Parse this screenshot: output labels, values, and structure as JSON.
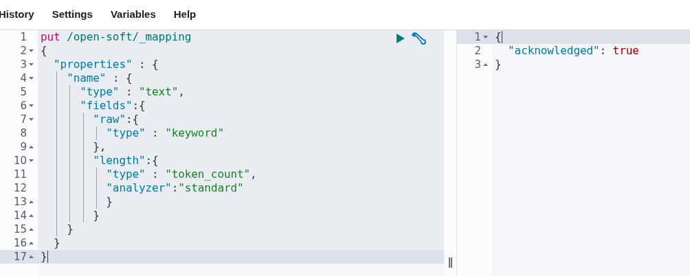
{
  "menu": [
    {
      "label": "History"
    },
    {
      "label": "Settings"
    },
    {
      "label": "Variables"
    },
    {
      "label": "Help"
    }
  ],
  "request_editor": {
    "lines": [
      {
        "number": "1",
        "selected": false,
        "tokens": [
          {
            "kind": "method",
            "text": "put"
          },
          {
            "kind": "url",
            "text": " /open-soft/_mapping"
          }
        ]
      },
      {
        "number": "2",
        "expanded": true,
        "selected": false,
        "tokens": [
          {
            "kind": "punct",
            "text": "{"
          }
        ]
      },
      {
        "number": "3",
        "expanded": true,
        "selected": false,
        "tokens": [
          {
            "kind": "key",
            "text": "  \"properties\""
          },
          {
            "kind": "punct",
            "text": " : {"
          }
        ]
      },
      {
        "number": "4",
        "expanded": true,
        "selected": false,
        "tokens": [
          {
            "kind": "key",
            "text": "    \"name\""
          },
          {
            "kind": "punct",
            "text": " : {"
          }
        ]
      },
      {
        "number": "5",
        "selected": false,
        "tokens": [
          {
            "kind": "key",
            "text": "      \"type\""
          },
          {
            "kind": "punct",
            "text": " : "
          },
          {
            "kind": "string",
            "text": "\"text\""
          },
          {
            "kind": "punct",
            "text": ","
          }
        ]
      },
      {
        "number": "6",
        "expanded": true,
        "selected": false,
        "tokens": [
          {
            "kind": "key",
            "text": "      \"fields\""
          },
          {
            "kind": "punct",
            "text": ":{"
          }
        ]
      },
      {
        "number": "7",
        "expanded": true,
        "selected": false,
        "tokens": [
          {
            "kind": "key",
            "text": "        \"raw\""
          },
          {
            "kind": "punct",
            "text": ":{"
          }
        ]
      },
      {
        "number": "8",
        "selected": false,
        "tokens": [
          {
            "kind": "key",
            "text": "          \"type\""
          },
          {
            "kind": "punct",
            "text": " : "
          },
          {
            "kind": "string",
            "text": "\"keyword\""
          }
        ]
      },
      {
        "number": "9",
        "expanded": false,
        "selected": false,
        "tokens": [
          {
            "kind": "punct",
            "text": "        },"
          }
        ]
      },
      {
        "number": "10",
        "expanded": true,
        "selected": false,
        "tokens": [
          {
            "kind": "key",
            "text": "        \"length\""
          },
          {
            "kind": "punct",
            "text": ":{"
          }
        ]
      },
      {
        "number": "11",
        "selected": false,
        "tokens": [
          {
            "kind": "key",
            "text": "          \"type\""
          },
          {
            "kind": "punct",
            "text": " : "
          },
          {
            "kind": "string",
            "text": "\"token_count\""
          },
          {
            "kind": "punct",
            "text": ","
          }
        ]
      },
      {
        "number": "12",
        "selected": false,
        "tokens": [
          {
            "kind": "key",
            "text": "          \"analyzer\""
          },
          {
            "kind": "punct",
            "text": ":"
          },
          {
            "kind": "string",
            "text": "\"standard\""
          }
        ]
      },
      {
        "number": "13",
        "expanded": false,
        "selected": false,
        "tokens": [
          {
            "kind": "punct",
            "text": "          }"
          }
        ]
      },
      {
        "number": "14",
        "expanded": false,
        "selected": false,
        "tokens": [
          {
            "kind": "punct",
            "text": "        }"
          }
        ]
      },
      {
        "number": "15",
        "expanded": false,
        "selected": false,
        "tokens": [
          {
            "kind": "punct",
            "text": "    }"
          }
        ]
      },
      {
        "number": "16",
        "expanded": false,
        "selected": false,
        "tokens": [
          {
            "kind": "punct",
            "text": "  }"
          }
        ]
      },
      {
        "number": "17",
        "expanded": false,
        "selected": true,
        "tokens": [
          {
            "kind": "punct",
            "text": "}"
          }
        ]
      }
    ]
  },
  "response_editor": {
    "lines": [
      {
        "number": "1",
        "expanded": true,
        "selected": true,
        "tokens": [
          {
            "kind": "punct",
            "text": "{"
          }
        ]
      },
      {
        "number": "2",
        "selected": false,
        "tokens": [
          {
            "kind": "key",
            "text": "  \"acknowledged\""
          },
          {
            "kind": "punct",
            "text": ": "
          },
          {
            "kind": "bool",
            "text": "true"
          }
        ]
      },
      {
        "number": "3",
        "expanded": false,
        "selected": false,
        "tokens": [
          {
            "kind": "punct",
            "text": "}"
          }
        ]
      }
    ]
  }
}
